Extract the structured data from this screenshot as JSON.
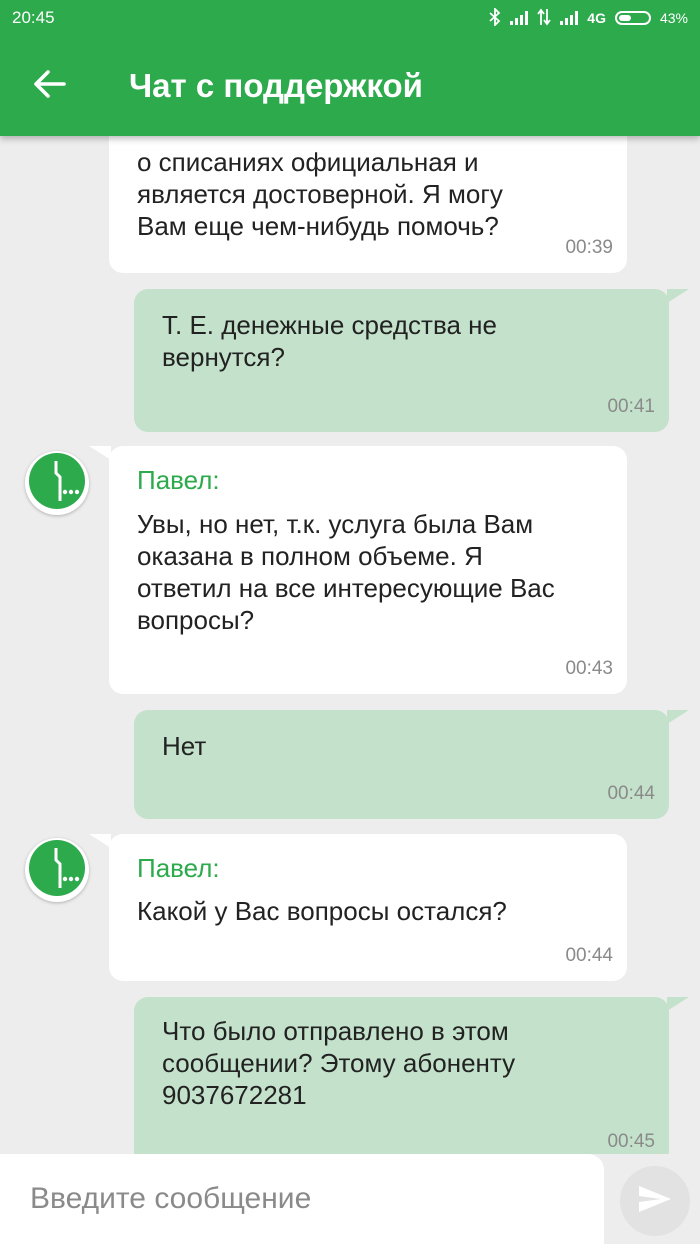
{
  "status_bar": {
    "time": "20:45",
    "network": "4G",
    "battery": "43%",
    "battery_level": 0.43
  },
  "header": {
    "title": "Чат с поддержкой",
    "back_icon": "arrow-left-icon"
  },
  "messages": [
    {
      "direction": "in",
      "sender": "",
      "text": "о списаниях официальная и\nявляется достоверной. Я могу\nВам еще чем-нибудь помочь?",
      "time": "00:39"
    },
    {
      "direction": "out",
      "text": "Т. Е. денежные средства не\nвернутся?",
      "time": "00:41"
    },
    {
      "direction": "in",
      "sender": "Павел:",
      "text": "Увы, но нет, т.к. услуга была Вам\nоказана в полном объеме. Я\nответил на все интересующие Вас\nвопросы?",
      "time": "00:43"
    },
    {
      "direction": "out",
      "text": "Нет",
      "time": "00:44"
    },
    {
      "direction": "in",
      "sender": "Павел:",
      "text": "Какой у Вас вопросы остался?",
      "time": "00:44"
    },
    {
      "direction": "out",
      "text": "Что было отправлено в этом\nсообщении? Этому абоненту\n9037672281",
      "time": "00:45"
    }
  ],
  "composer": {
    "placeholder": "Введите сообщение",
    "send_icon": "send-icon"
  },
  "colors": {
    "brand": "#2daa4c",
    "outgoing_bubble": "#c4e2cb",
    "background": "#ededed"
  }
}
